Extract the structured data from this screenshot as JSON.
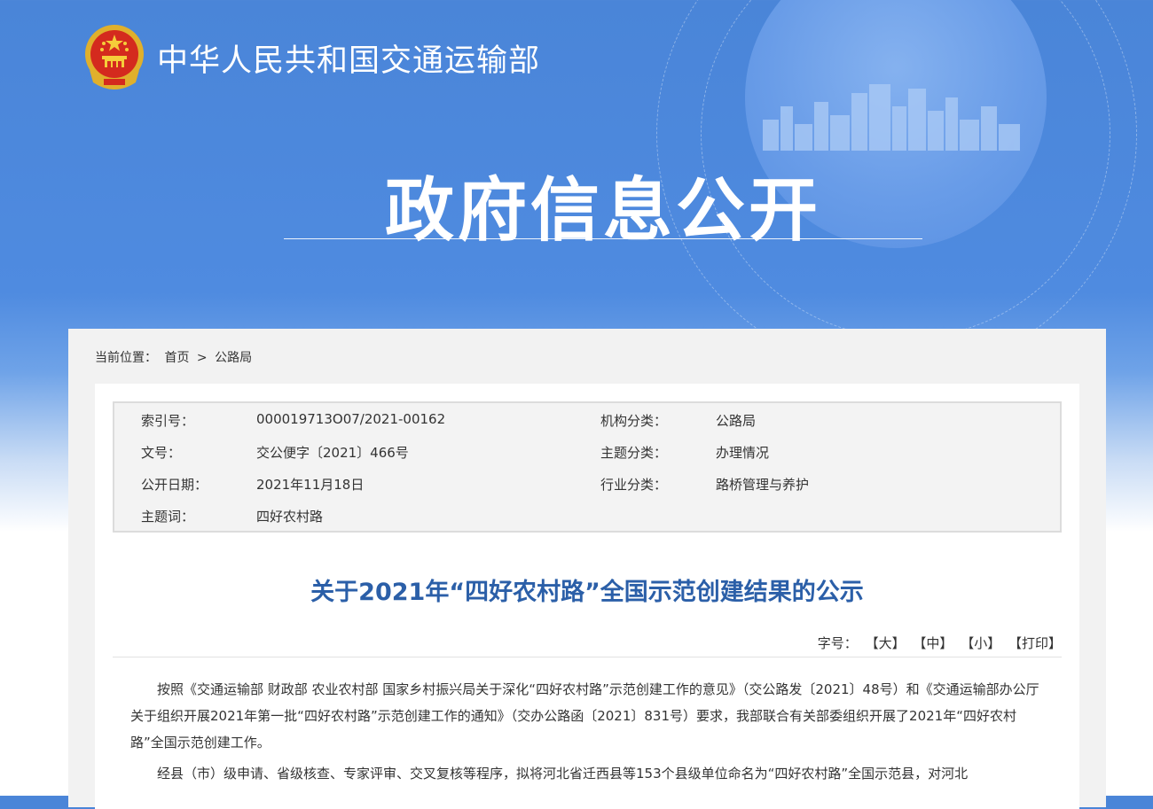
{
  "header": {
    "site_title": "中华人民共和国交通运输部",
    "hero_title": "政府信息公开"
  },
  "breadcrumb": {
    "label": "当前位置：",
    "home": "首页",
    "separator": ">",
    "current": "公路局"
  },
  "meta": {
    "rows": [
      {
        "k1": "索引号：",
        "v1": "000019713O07/2021-00162",
        "k2": "机构分类：",
        "v2": "公路局"
      },
      {
        "k1": "文号：",
        "v1": "交公便字〔2021〕466号",
        "k2": "主题分类：",
        "v2": "办理情况"
      },
      {
        "k1": "公开日期：",
        "v1": "2021年11月18日",
        "k2": "行业分类：",
        "v2": "路桥管理与养护"
      },
      {
        "k1": "主题词：",
        "v1": "四好农村路",
        "k2": "",
        "v2": ""
      }
    ]
  },
  "article": {
    "title": "关于2021年“四好农村路”全国示范创建结果的公示",
    "font_size_label": "字号：",
    "font_large": "【大】",
    "font_medium": "【中】",
    "font_small": "【小】",
    "print": "【打印】",
    "paragraphs": [
      "按照《交通运输部 财政部 农业农村部 国家乡村振兴局关于深化“四好农村路”示范创建工作的意见》（交公路发〔2021〕48号）和《交通运输部办公厅关于组织开展2021年第一批“四好农村路”示范创建工作的通知》（交办公路函〔2021〕831号）要求，我部联合有关部委组织开展了2021年“四好农村路”全国示范创建工作。",
      "经县（市）级申请、省级核查、专家评审、交叉复核等程序，拟将河北省迁西县等153个县级单位命名为“四好农村路”全国示范县，对河北"
    ]
  },
  "colors": {
    "banner": "#4f8be0",
    "title_blue": "#2b5fa8"
  }
}
